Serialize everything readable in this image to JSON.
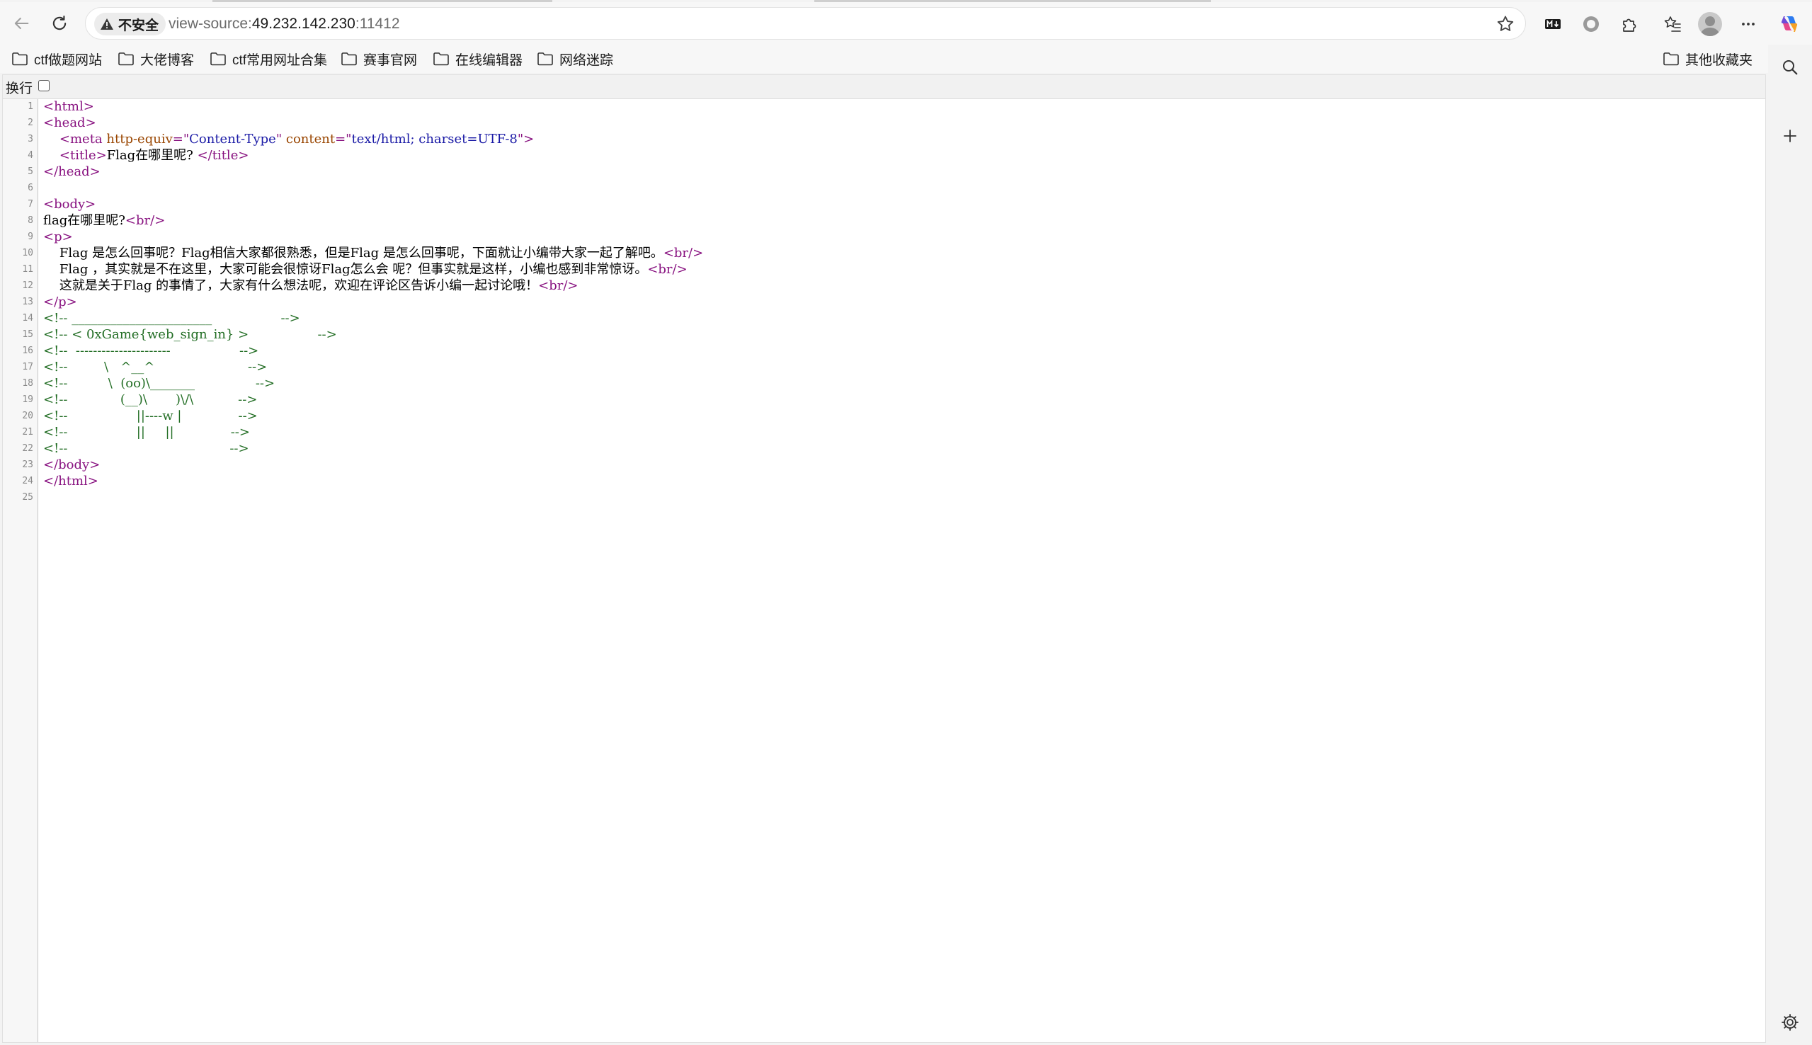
{
  "browser": {
    "security_label": "不安全",
    "url_scheme": "view-source:",
    "url_host": "49.232.142.230",
    "url_port": ":11412"
  },
  "bookmarks": [
    {
      "label": "ctf做题网站"
    },
    {
      "label": "大佬博客"
    },
    {
      "label": "ctf常用网址合集"
    },
    {
      "label": "赛事官网"
    },
    {
      "label": "在线编辑器"
    },
    {
      "label": "网络迷踪"
    }
  ],
  "other_bookmarks": "其他收藏夹",
  "view_source": {
    "wrap_label": "换行",
    "wrap_checked": false,
    "lines": [
      {
        "n": "1",
        "parts": [
          {
            "c": "tag",
            "t": "<html>"
          }
        ]
      },
      {
        "n": "2",
        "parts": [
          {
            "c": "tag",
            "t": "<head>"
          }
        ]
      },
      {
        "n": "3",
        "parts": [
          {
            "c": "",
            "t": "    "
          },
          {
            "c": "tag",
            "t": "<meta "
          },
          {
            "c": "attr",
            "t": "http-equiv"
          },
          {
            "c": "tag",
            "t": "=\""
          },
          {
            "c": "val",
            "t": "Content-Type"
          },
          {
            "c": "tag",
            "t": "\" "
          },
          {
            "c": "attr",
            "t": "content"
          },
          {
            "c": "tag",
            "t": "=\""
          },
          {
            "c": "val",
            "t": "text/html; charset=UTF-8"
          },
          {
            "c": "tag",
            "t": "\">"
          }
        ]
      },
      {
        "n": "4",
        "parts": [
          {
            "c": "",
            "t": "    "
          },
          {
            "c": "tag",
            "t": "<title>"
          },
          {
            "c": "",
            "t": "Flag在哪里呢? "
          },
          {
            "c": "tag",
            "t": "</title>"
          }
        ]
      },
      {
        "n": "5",
        "parts": [
          {
            "c": "tag",
            "t": "</head>"
          }
        ]
      },
      {
        "n": "6",
        "parts": []
      },
      {
        "n": "7",
        "parts": [
          {
            "c": "tag",
            "t": "<body>"
          }
        ]
      },
      {
        "n": "8",
        "parts": [
          {
            "c": "",
            "t": "flag在哪里呢?"
          },
          {
            "c": "tag",
            "t": "<br/>"
          }
        ]
      },
      {
        "n": "9",
        "parts": [
          {
            "c": "tag",
            "t": "<p>"
          }
        ]
      },
      {
        "n": "10",
        "parts": [
          {
            "c": "",
            "t": "    Flag 是怎么回事呢？Flag相信大家都很熟悉，但是Flag 是怎么回事呢，下面就让小编带大家一起了解吧。"
          },
          {
            "c": "tag",
            "t": "<br/>"
          }
        ]
      },
      {
        "n": "11",
        "parts": [
          {
            "c": "",
            "t": "    Flag ，其实就是不在这里，大家可能会很惊讶Flag怎么会 呢？但事实就是这样，小编也感到非常惊讶。"
          },
          {
            "c": "tag",
            "t": "<br/>"
          }
        ]
      },
      {
        "n": "12",
        "parts": [
          {
            "c": "",
            "t": "    这就是关于Flag 的事情了，大家有什么想法呢，欢迎在评论区告诉小编一起讨论哦！"
          },
          {
            "c": "tag",
            "t": "<br/>"
          }
        ]
      },
      {
        "n": "13",
        "parts": [
          {
            "c": "tag",
            "t": "</p>"
          }
        ]
      },
      {
        "n": "14",
        "parts": [
          {
            "c": "cmt",
            "t": "<!-- ______________________                 -->"
          }
        ]
      },
      {
        "n": "15",
        "parts": [
          {
            "c": "cmt",
            "t": "<!-- < 0xGame{web_sign_in} >                 -->"
          }
        ]
      },
      {
        "n": "16",
        "parts": [
          {
            "c": "cmt",
            "t": "<!--  ----------------------                 -->"
          }
        ]
      },
      {
        "n": "17",
        "parts": [
          {
            "c": "cmt",
            "t": "<!--         \\   ^__^                       -->"
          }
        ]
      },
      {
        "n": "18",
        "parts": [
          {
            "c": "cmt",
            "t": "<!--          \\  (oo)\\_______               -->"
          }
        ]
      },
      {
        "n": "19",
        "parts": [
          {
            "c": "cmt",
            "t": "<!--             (__)\\       )\\/\\           -->"
          }
        ]
      },
      {
        "n": "20",
        "parts": [
          {
            "c": "cmt",
            "t": "<!--                 ||----w |              -->"
          }
        ]
      },
      {
        "n": "21",
        "parts": [
          {
            "c": "cmt",
            "t": "<!--                 ||     ||              -->"
          }
        ]
      },
      {
        "n": "22",
        "parts": [
          {
            "c": "cmt",
            "t": "<!--                                        -->"
          }
        ]
      },
      {
        "n": "23",
        "parts": [
          {
            "c": "tag",
            "t": "</body>"
          }
        ]
      },
      {
        "n": "24",
        "parts": [
          {
            "c": "tag",
            "t": "</html>"
          }
        ]
      },
      {
        "n": "25",
        "parts": []
      }
    ]
  },
  "icons": {
    "back": "back-arrow-icon",
    "refresh": "refresh-icon",
    "warning": "warning-icon",
    "favorite": "star-icon",
    "markdown": "markdown-icon",
    "record": "record-icon",
    "extensions": "puzzle-icon",
    "favorites": "favorites-icon",
    "profile": "avatar",
    "more": "more-icon",
    "copilot": "copilot-icon",
    "search": "search-icon",
    "add": "plus-icon",
    "settings": "gear-icon",
    "folder": "folder-icon"
  },
  "colors": {
    "tag": "#881280",
    "attribute": "#994500",
    "value": "#1a1aa6",
    "comment": "#236e25"
  }
}
